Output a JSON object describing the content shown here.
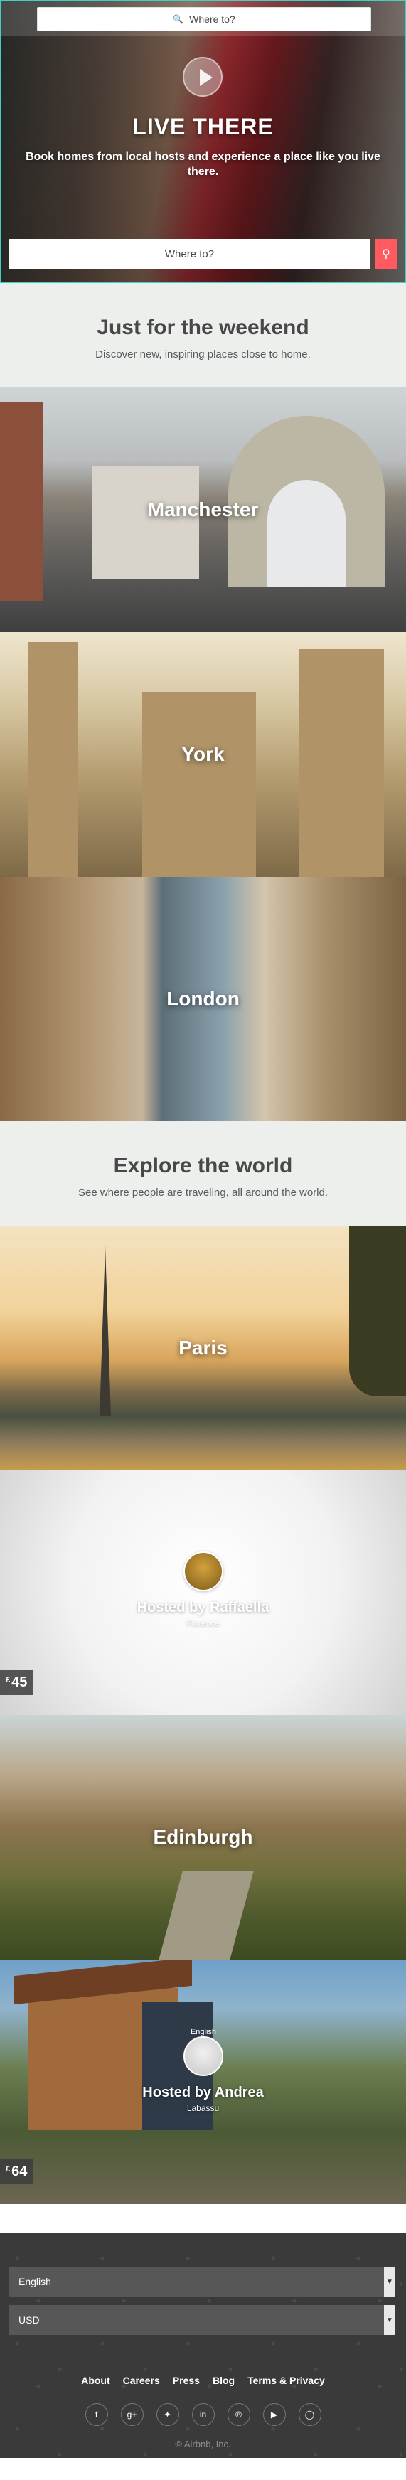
{
  "header": {
    "search_placeholder": "Where to?"
  },
  "hero": {
    "title": "LIVE THERE",
    "subtitle": "Book homes from local hosts and experience a place like you live there.",
    "search_placeholder": "Where to?"
  },
  "weekend": {
    "title": "Just for the weekend",
    "subtitle": "Discover new, inspiring places close to home.",
    "cities": [
      "Manchester",
      "York",
      "London"
    ]
  },
  "explore": {
    "title": "Explore the world",
    "subtitle": "See where people are traveling, all around the world.",
    "paris": "Paris",
    "raffaella": {
      "hosted": "Hosted by Raffaella",
      "city": "Florence",
      "currency": "£",
      "price": "45"
    },
    "edinburgh": "Edinburgh",
    "andrea": {
      "badge": "English",
      "hosted": "Hosted by Andrea",
      "city": "Labassu",
      "currency": "£",
      "price": "64"
    }
  },
  "footer": {
    "language": "English",
    "currency": "USD",
    "links": [
      "About",
      "Careers",
      "Press",
      "Blog",
      "Terms & Privacy"
    ],
    "social_icons": [
      "facebook-icon",
      "google-plus-icon",
      "twitter-icon",
      "linkedin-icon",
      "pinterest-icon",
      "youtube-icon",
      "instagram-icon"
    ],
    "copyright": "© Airbnb, Inc."
  },
  "colors": {
    "accent": "#ff5a5f",
    "teal": "#3fd1c6",
    "section_bg": "#edefed",
    "footer_bg": "#3a3a3a"
  }
}
